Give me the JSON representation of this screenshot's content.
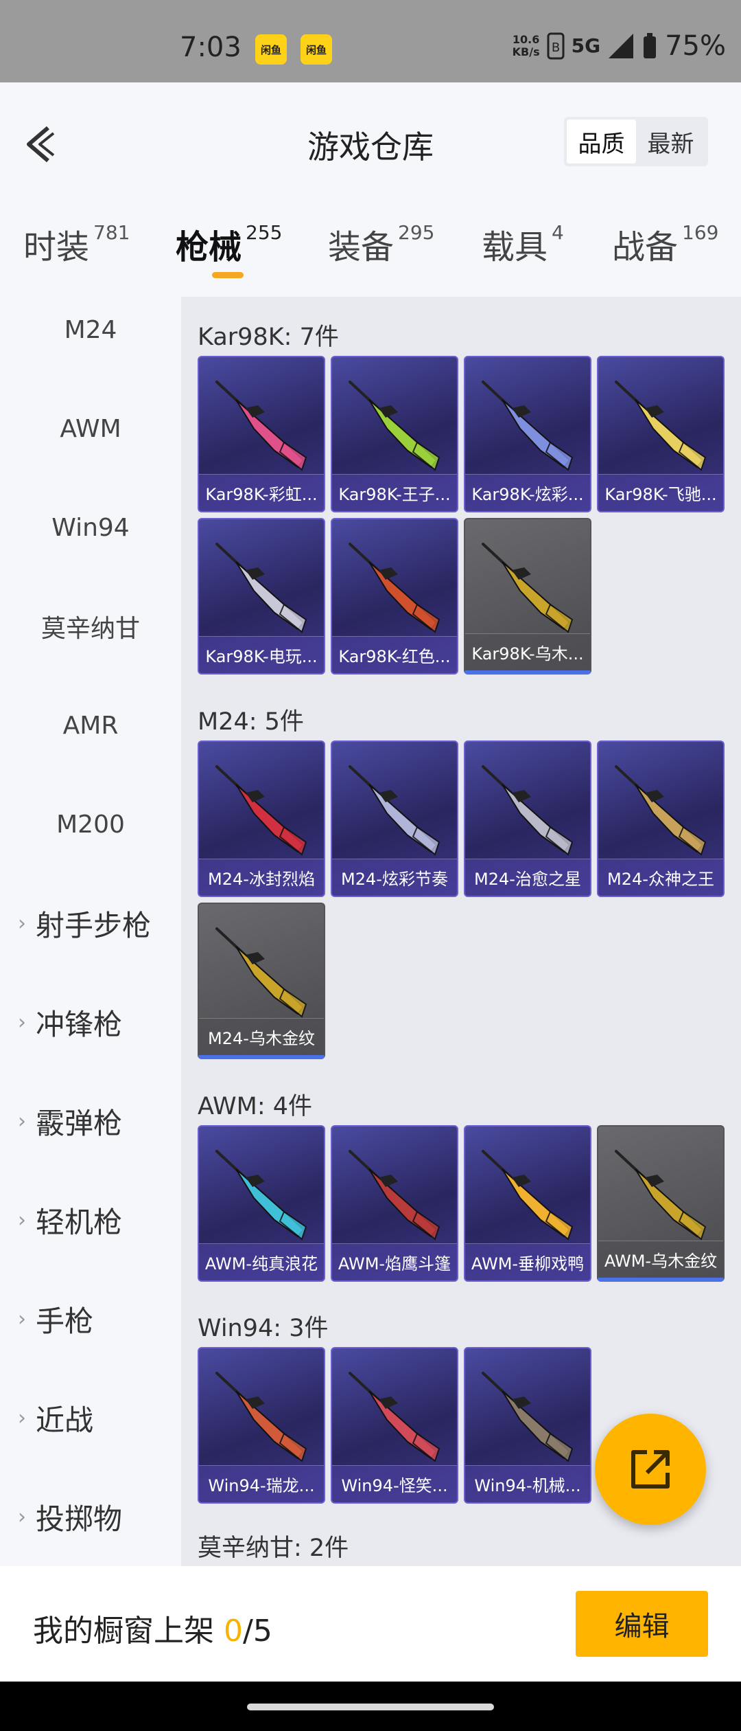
{
  "status": {
    "time": "7:03",
    "app_icons": [
      "闲鱼",
      "闲鱼"
    ],
    "net_speed_value": "10.6",
    "net_speed_unit": "KB/s",
    "network": "5G",
    "battery": "75%"
  },
  "header": {
    "title": "游戏仓库",
    "sort_options": [
      "品质",
      "最新"
    ],
    "sort_active": "品质"
  },
  "tabs": [
    {
      "label": "时装",
      "count": "781"
    },
    {
      "label": "枪械",
      "count": "255"
    },
    {
      "label": "装备",
      "count": "295"
    },
    {
      "label": "载具",
      "count": "4"
    },
    {
      "label": "战备",
      "count": "169"
    }
  ],
  "active_tab": "枪械",
  "sidebar": {
    "items": [
      "M24",
      "AWM",
      "Win94",
      "莫辛纳甘",
      "AMR",
      "M200"
    ],
    "groups": [
      "射手步枪",
      "冲锋枪",
      "霰弹枪",
      "轻机枪",
      "手枪",
      "近战",
      "投掷物"
    ]
  },
  "sections": [
    {
      "title": "Kar98K: 7件",
      "items": [
        {
          "name": "Kar98K-彩虹...",
          "style": "purple",
          "gun": "#e0508a"
        },
        {
          "name": "Kar98K-王子...",
          "style": "purple",
          "gun": "#9ad13a"
        },
        {
          "name": "Kar98K-炫彩...",
          "style": "purple",
          "gun": "#7f8fe0"
        },
        {
          "name": "Kar98K-飞驰...",
          "style": "purple",
          "gun": "#e8d060"
        },
        {
          "name": "Kar98K-电玩...",
          "style": "purple",
          "gun": "#c8c8d8"
        },
        {
          "name": "Kar98K-红色...",
          "style": "purple",
          "gun": "#d0502e"
        },
        {
          "name": "Kar98K-乌木...",
          "style": "gray",
          "gun": "#c8a42a"
        }
      ]
    },
    {
      "title": "M24: 5件",
      "items": [
        {
          "name": "M24-冰封烈焰",
          "style": "purple",
          "gun": "#d03040"
        },
        {
          "name": "M24-炫彩节奏",
          "style": "purple",
          "gun": "#b0b4d8"
        },
        {
          "name": "M24-治愈之星",
          "style": "purple",
          "gun": "#b8b8c8"
        },
        {
          "name": "M24-众神之王",
          "style": "purple",
          "gun": "#c8a25a"
        },
        {
          "name": "M24-乌木金纹",
          "style": "gray",
          "gun": "#c8a42a"
        }
      ]
    },
    {
      "title": "AWM: 4件",
      "items": [
        {
          "name": "AWM-纯真浪花",
          "style": "purple",
          "gun": "#40c0d8"
        },
        {
          "name": "AWM-焰鹰斗篷",
          "style": "purple",
          "gun": "#b83a3a"
        },
        {
          "name": "AWM-垂柳戏鸭",
          "style": "purple",
          "gun": "#f0b030"
        },
        {
          "name": "AWM-乌木金纹",
          "style": "gray",
          "gun": "#c8a42a"
        }
      ]
    },
    {
      "title": "Win94: 3件",
      "items": [
        {
          "name": "Win94-瑞龙...",
          "style": "purple",
          "gun": "#d05a3a"
        },
        {
          "name": "Win94-怪笑...",
          "style": "purple",
          "gun": "#d04a5a"
        },
        {
          "name": "Win94-机械...",
          "style": "purple",
          "gun": "#8a7a6a"
        }
      ]
    },
    {
      "title": "莫辛纳甘: 2件",
      "items": []
    }
  ],
  "bottom": {
    "label": "我的橱窗上架",
    "current": "0",
    "total": "/5",
    "edit_label": "编辑"
  }
}
